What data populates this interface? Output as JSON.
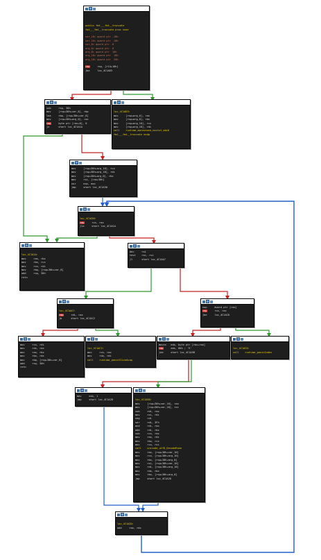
{
  "colors": {
    "true_edge": "#2e9a2e",
    "false_edge": "#c82020",
    "uncond_edge": "#2060d0",
    "node_bg": "#1e1e1e",
    "label": "#f0d000"
  },
  "node_icons": [
    "graph-icon",
    "pencil-icon",
    "table-icon"
  ],
  "nodes": [
    {
      "id": "entry",
      "lines": [
        {
          "t": "",
          "c": "mn"
        },
        {
          "t": "",
          "c": "mn"
        },
        {
          "t": "",
          "c": "mn"
        },
        {
          "t": "public fmt___fmt__truncate",
          "c": "fn"
        },
        {
          "t": "fmt___fmt__truncate proc near",
          "c": "fn"
        },
        {
          "t": "",
          "c": "mn"
        },
        {
          "t": "var_18= qword ptr -18h",
          "c": "dim"
        },
        {
          "t": "var_10= qword ptr -10h",
          "c": "dim"
        },
        {
          "t": "var_8= qword ptr -8",
          "c": "dim"
        },
        {
          "t": "arg_0= qword ptr  8",
          "c": "dim"
        },
        {
          "t": "arg_8= qword ptr  10h",
          "c": "dim"
        },
        {
          "t": "arg_10= qword ptr  18h",
          "c": "dim"
        },
        {
          "t": "arg_18= qword ptr  20h",
          "c": "dim"
        },
        {
          "t": "",
          "c": "mn"
        },
        {
          "t": "cmp     rsp, [r14+10h]",
          "c": "mn",
          "hl": true
        },
        {
          "t": "jbe     loc_4C1AD3",
          "c": "mn"
        }
      ]
    },
    {
      "id": "prologue",
      "lines": [
        {
          "t": "sub     rsp, 30h",
          "c": "mn"
        },
        {
          "t": "mov     [rsp+30h+var_8], rbp",
          "c": "mn"
        },
        {
          "t": "lea     rbp, [rsp+30h+var_8]",
          "c": "mn"
        },
        {
          "t": "mov     [rsp+30h+arg_0], rax",
          "c": "mn"
        },
        {
          "t": "cmp     byte ptr [rax+0], 0",
          "c": "mn",
          "hl": true
        },
        {
          "t": "jz      short loc_4C1A1A",
          "c": "mn"
        }
      ]
    },
    {
      "id": "morestack",
      "lines": [
        {
          "t": "",
          "c": "mn"
        },
        {
          "t": "loc_4C1AD3:",
          "c": "lbl"
        },
        {
          "t": "mov     [rsp+arg_0], rax",
          "c": "mn"
        },
        {
          "t": "mov     [rsp+arg_8], rbx",
          "c": "mn"
        },
        {
          "t": "mov     [rsp+arg_10], rcx",
          "c": "mn"
        },
        {
          "t": "mov     [rsp+arg_18], rdi",
          "c": "mn"
        },
        {
          "t": "call    runtime_morestack_noctxt_abi0",
          "c": "fn"
        },
        {
          "t": "fmt___fmt__truncate endp",
          "c": "fn"
        }
      ]
    },
    {
      "id": "spill",
      "lines": [
        {
          "t": "mov     [rsp+30h+arg_10], rcx",
          "c": "mn"
        },
        {
          "t": "mov     [rsp+30h+arg_18], rdi",
          "c": "mn"
        },
        {
          "t": "mov     [rsp+30h+arg_8], rbx",
          "c": "mn"
        },
        {
          "t": "mov     rsi, [rax+30h]",
          "c": "mn"
        },
        {
          "t": "xor     eax, eax",
          "c": "mn"
        },
        {
          "t": "jmp     short loc_4C1A30",
          "c": "mn"
        }
      ]
    },
    {
      "id": "loop",
      "lines": [
        {
          "t": "",
          "c": "mn"
        },
        {
          "t": "loc_4C1A30:",
          "c": "lbl"
        },
        {
          "t": "cmp     rcx, rax",
          "c": "mn",
          "hl": true
        },
        {
          "t": "jle     short loc_4C1A1A",
          "c": "mn"
        }
      ]
    },
    {
      "id": "ret1",
      "lines": [
        {
          "t": "",
          "c": "mn"
        },
        {
          "t": "loc_4C1A1A:",
          "c": "lbl"
        },
        {
          "t": "mov     rax, rbx",
          "c": "mn"
        },
        {
          "t": "mov     rbx, rcx",
          "c": "mn"
        },
        {
          "t": "mov     rcx, rdi",
          "c": "mn"
        },
        {
          "t": "mov     rbp, [rsp+30h+var_8]",
          "c": "mn"
        },
        {
          "t": "add     rsp, 30h",
          "c": "mn"
        },
        {
          "t": "retn",
          "c": "mn"
        }
      ]
    },
    {
      "id": "dec",
      "lines": [
        {
          "t": "dec     rsi",
          "c": "mn"
        },
        {
          "t": "test    rsi, rsi",
          "c": "mn"
        },
        {
          "t": "jl      short loc_4C1AA7",
          "c": "mn"
        }
      ]
    },
    {
      "id": "aa7",
      "lines": [
        {
          "t": "",
          "c": "mn"
        },
        {
          "t": "loc_4C1AA7:",
          "c": "lbl"
        },
        {
          "t": "cmp     rdi, rax",
          "c": "mn",
          "hl": true
        },
        {
          "t": "jb      short loc_4C1AC2",
          "c": "mn"
        }
      ]
    },
    {
      "id": "nop",
      "lines": [
        {
          "t": "nop     dword ptr [rax]",
          "c": "mn"
        },
        {
          "t": "cmp     rcx, rax",
          "c": "mn",
          "hl": true
        },
        {
          "t": "jbe     loc_4C1ACD",
          "c": "mn"
        }
      ]
    },
    {
      "id": "ret2",
      "lines": [
        {
          "t": "mov     rcx, rdi",
          "c": "mn"
        },
        {
          "t": "mov     rdx, rax",
          "c": "mn"
        },
        {
          "t": "mov     rax, rbx",
          "c": "mn"
        },
        {
          "t": "mov     rbx, rdx",
          "c": "mn"
        },
        {
          "t": "mov     rbp, [rsp+30h+var_8]",
          "c": "mn"
        },
        {
          "t": "add     rsp, 30h",
          "c": "mn"
        },
        {
          "t": "retn",
          "c": "mn"
        }
      ]
    },
    {
      "id": "ac2",
      "lines": [
        {
          "t": "",
          "c": "mn"
        },
        {
          "t": "loc_4C1AC2:",
          "c": "lbl"
        },
        {
          "t": "mov     rcx, rax",
          "c": "mn"
        },
        {
          "t": "mov     rdx, rdi",
          "c": "mn"
        },
        {
          "t": "call    runtime_panicSliceAcap",
          "c": "fn"
        }
      ]
    },
    {
      "id": "movzx",
      "lines": [
        {
          "t": "movzx   edx, byte ptr [rbx+rax]",
          "c": "mn"
        },
        {
          "t": "cmp     edx, 80h ; '€'",
          "c": "mn",
          "hl": true
        },
        {
          "t": "jnb     short loc_4C1A5B",
          "c": "mn"
        }
      ]
    },
    {
      "id": "acd",
      "lines": [
        {
          "t": "",
          "c": "mn"
        },
        {
          "t": "loc_4C1ACD:",
          "c": "lbl"
        },
        {
          "t": "call    runtime_panicIndex",
          "c": "fn"
        }
      ]
    },
    {
      "id": "inc",
      "lines": [
        {
          "t": "mov     edx, 1",
          "c": "mn"
        },
        {
          "t": "jmp     short loc_4C1A2D",
          "c": "mn"
        }
      ]
    },
    {
      "id": "a5b",
      "lines": [
        {
          "t": "",
          "c": "mn"
        },
        {
          "t": "loc_4C1A5B:",
          "c": "lbl"
        },
        {
          "t": "mov     [rsp+30h+var_10], rax",
          "c": "mn"
        },
        {
          "t": "mov     [rsp+30h+var_18], rsi",
          "c": "mn"
        },
        {
          "t": "sub     rdi, rax",
          "c": "mn"
        },
        {
          "t": "mov     rsi, rdi",
          "c": "mn"
        },
        {
          "t": "neg     rdi",
          "c": "mn"
        },
        {
          "t": "sar     rdi, 3Fh",
          "c": "mn"
        },
        {
          "t": "and     rdi, rax",
          "c": "mn"
        },
        {
          "t": "add     rdi, rbx",
          "c": "mn"
        },
        {
          "t": "sub     rcx, rax",
          "c": "mn"
        },
        {
          "t": "mov     rax, rdi",
          "c": "mn"
        },
        {
          "t": "mov     rbx, rcx",
          "c": "mn"
        },
        {
          "t": "mov     rcx, rsi",
          "c": "mn"
        },
        {
          "t": "call    unicode_utf8_DecodeRune",
          "c": "fn"
        },
        {
          "t": "mov     rax, [rsp+30h+var_10]",
          "c": "mn"
        },
        {
          "t": "mov     rcx, [rsp+30h+arg_10]",
          "c": "mn"
        },
        {
          "t": "mov     rbx, [rsp+30h+arg_8]",
          "c": "mn"
        },
        {
          "t": "mov     rsi, [rsp+30h+var_18]",
          "c": "mn"
        },
        {
          "t": "mov     rdi, [rsp+30h+arg_18]",
          "c": "mn"
        },
        {
          "t": "mov     rdx, rbx",
          "c": "mn"
        },
        {
          "t": "mov     rbx, [rsp+30h+arg_8]",
          "c": "mn"
        },
        {
          "t": "jmp     short loc_4C1A2D",
          "c": "mn"
        }
      ]
    },
    {
      "id": "a2d",
      "lines": [
        {
          "t": "",
          "c": "mn"
        },
        {
          "t": "loc_4C1A2D:",
          "c": "lbl"
        },
        {
          "t": "add     rax, rdx",
          "c": "mn"
        }
      ]
    }
  ]
}
